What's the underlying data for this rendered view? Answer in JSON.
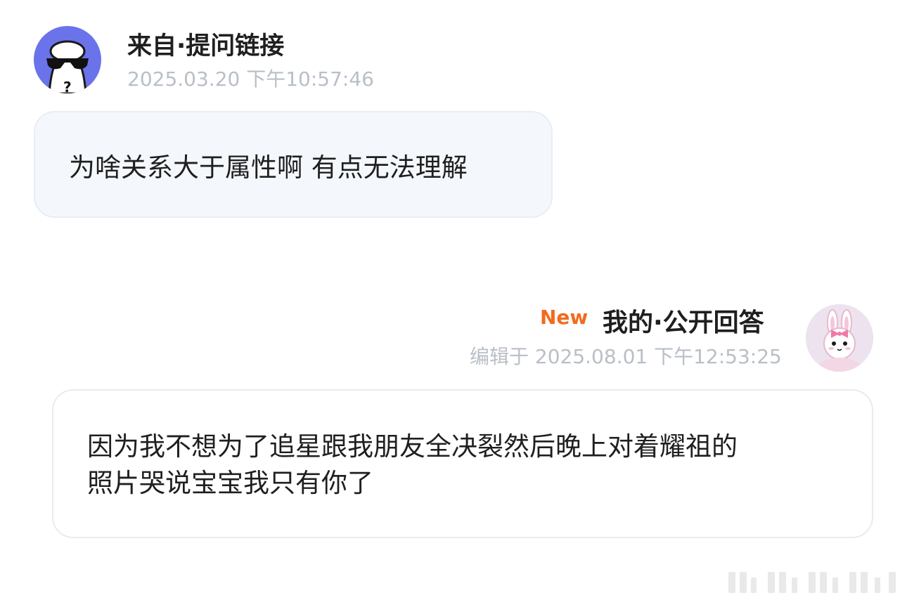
{
  "question": {
    "avatar_icon": "sunglasses-ghost-avatar",
    "source_label": "来自·提问链接",
    "timestamp": "2025.03.20 下午10:57:46",
    "text": "为啥关系大于属性啊 有点无法理解"
  },
  "answer": {
    "new_badge": "New",
    "label": "我的·公开回答",
    "edited_timestamp": "编辑于 2025.08.01 下午12:53:25",
    "avatar_icon": "pink-bunny-avatar",
    "lines": [
      "因为我不想为了追星跟我朋友全决裂然后晚上对着耀祖的",
      "照片哭说宝宝我只有你了"
    ]
  },
  "colors": {
    "accent_orange": "#F26B1D",
    "avatar_purple": "#6B73EB",
    "timestamp_gray": "#B9BFC7",
    "bubble_bg": "#F4F8FC"
  }
}
